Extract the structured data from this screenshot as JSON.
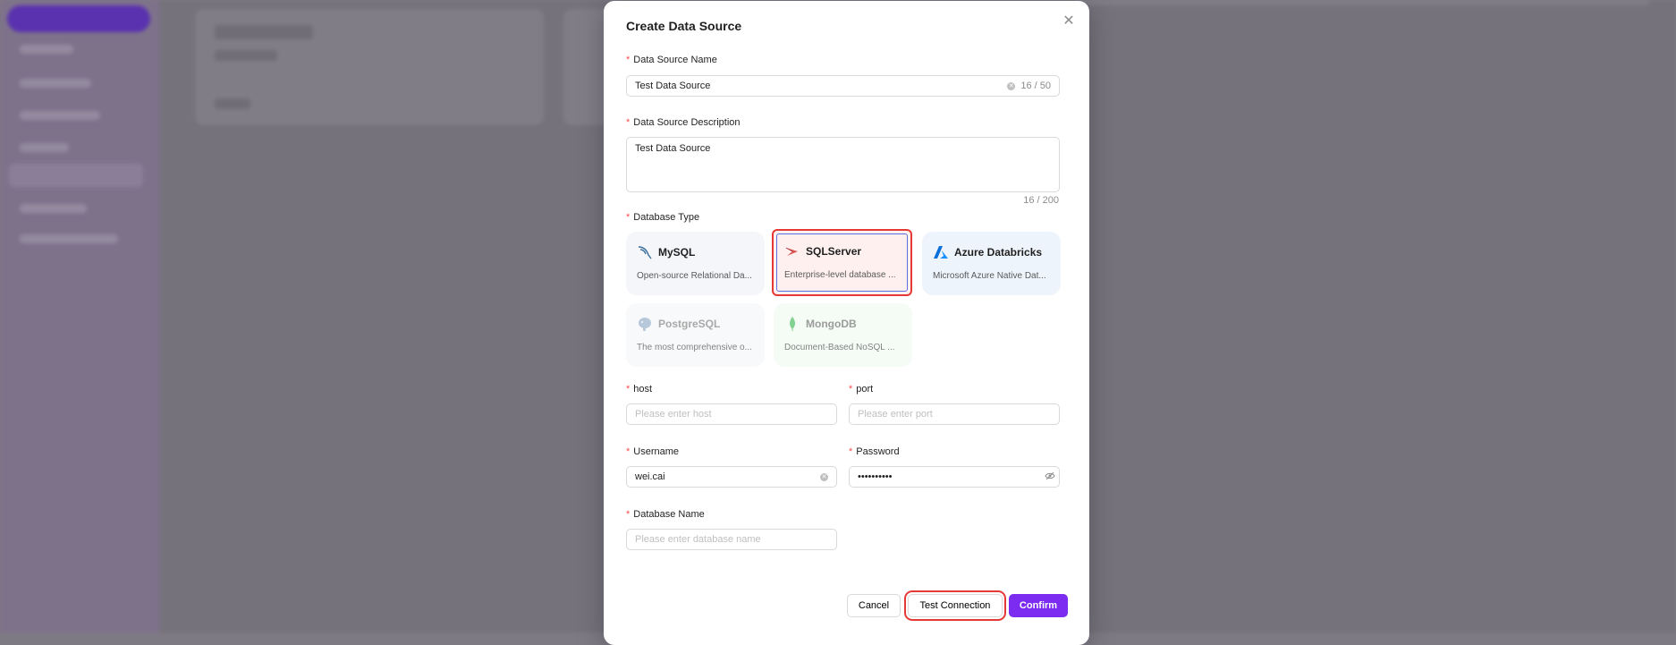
{
  "modal": {
    "title": "Create Data Source"
  },
  "form": {
    "name": {
      "label": "Data Source Name",
      "value": "Test Data Source",
      "counter": "16 / 50"
    },
    "description": {
      "label": "Data Source Description",
      "value": "Test Data Source",
      "counter": "16 / 200"
    },
    "db_type": {
      "label": "Database Type",
      "options": [
        {
          "name": "MySQL",
          "desc": "Open-source Relational Da...",
          "state": "available"
        },
        {
          "name": "SQLServer",
          "desc": "Enterprise-level database ...",
          "state": "selected"
        },
        {
          "name": "Azure Databricks",
          "desc": "Microsoft Azure Native Dat...",
          "state": "available"
        },
        {
          "name": "PostgreSQL",
          "desc": "The most comprehensive o...",
          "state": "disabled"
        },
        {
          "name": "MongoDB",
          "desc": "Document-Based NoSQL ...",
          "state": "disabled"
        }
      ]
    },
    "host": {
      "label": "host",
      "placeholder": "Please enter host",
      "value": ""
    },
    "port": {
      "label": "port",
      "placeholder": "Please enter port",
      "value": ""
    },
    "username": {
      "label": "Username",
      "value": "wei.cai"
    },
    "password": {
      "label": "Password",
      "value": "••••••••••"
    },
    "database_name": {
      "label": "Database Name",
      "placeholder": "Please enter database name",
      "value": ""
    }
  },
  "footer": {
    "cancel_label": "Cancel",
    "test_label": "Test Connection",
    "confirm_label": "Confirm"
  },
  "colors": {
    "accent": "#7b2cf0",
    "required": "#ff4d4f",
    "highlight": "#e53935"
  }
}
